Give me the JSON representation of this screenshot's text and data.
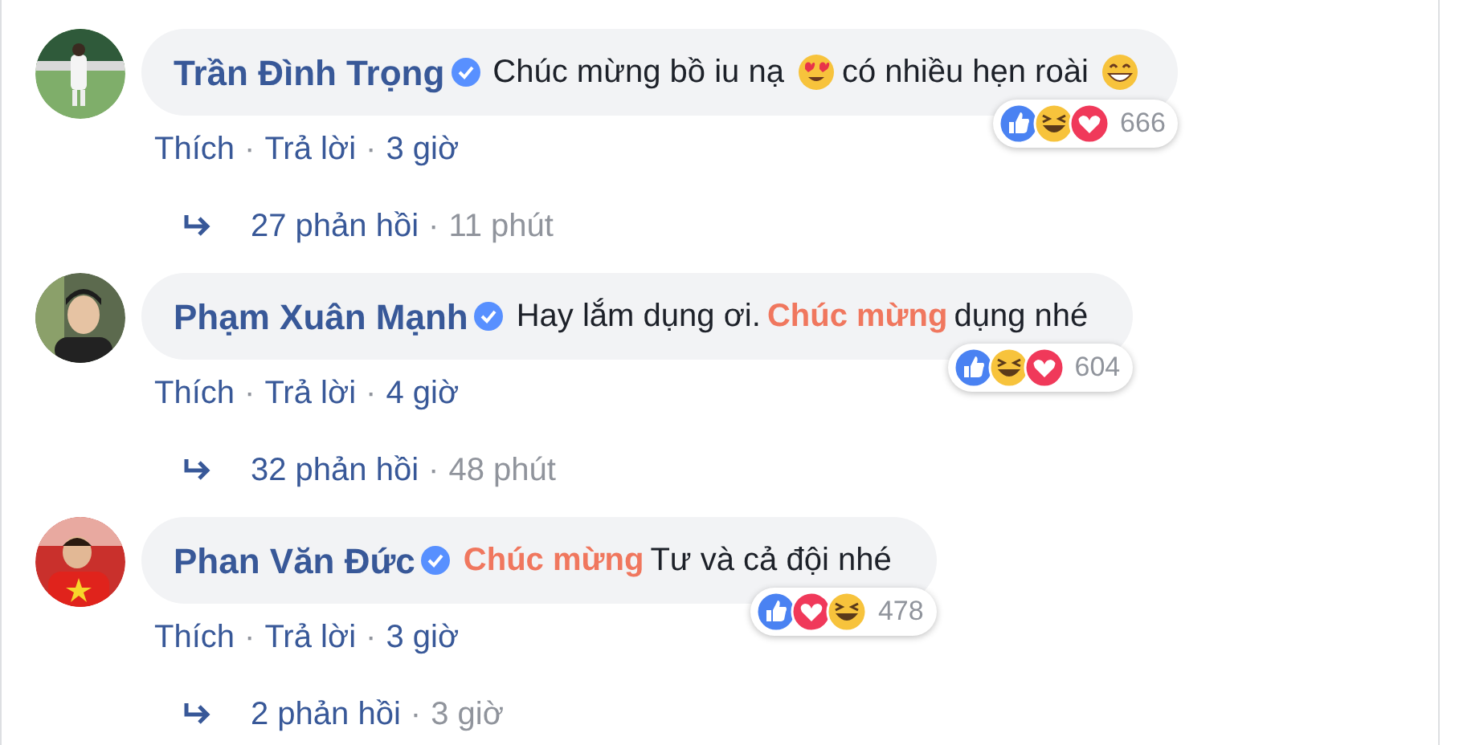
{
  "comments": [
    {
      "author": "Trần Đình Trọng",
      "avatar": {
        "kind": "picture"
      },
      "body": [
        {
          "kind": "text",
          "text": "Chúc mừng bồ iu nạ"
        },
        {
          "kind": "heart-eyes-emoji"
        },
        {
          "kind": "text",
          "text": "có nhiều hẹn roài"
        },
        {
          "kind": "grin-emoji"
        }
      ],
      "reactions": [
        {
          "kind": "like"
        },
        {
          "kind": "haha"
        },
        {
          "kind": "love"
        }
      ],
      "reaction_count": "666",
      "actions": [
        {
          "kind": "like",
          "text": "Thích"
        },
        {
          "kind": "separator",
          "text": "·"
        },
        {
          "kind": "reply",
          "text": "Trả lời"
        },
        {
          "kind": "separator",
          "text": "·"
        },
        {
          "kind": "time",
          "text": "3 giờ"
        }
      ],
      "replies": [
        {
          "kind": "count",
          "text": "27 phản hồi"
        },
        {
          "kind": "separator",
          "text": "·"
        },
        {
          "kind": "time",
          "text": "11 phút"
        }
      ]
    },
    {
      "author": "Phạm Xuân Mạnh",
      "avatar": {
        "kind": "picture"
      },
      "body": [
        {
          "kind": "text",
          "text": "Hay lắm dụng ơi."
        },
        {
          "kind": "highlight",
          "text": "Chúc mừng"
        },
        {
          "kind": "text",
          "text": "dụng nhé"
        }
      ],
      "reactions": [
        {
          "kind": "like"
        },
        {
          "kind": "haha"
        },
        {
          "kind": "love"
        }
      ],
      "reaction_count": "604",
      "actions": [
        {
          "kind": "like",
          "text": "Thích"
        },
        {
          "kind": "separator",
          "text": "·"
        },
        {
          "kind": "reply",
          "text": "Trả lời"
        },
        {
          "kind": "separator",
          "text": "·"
        },
        {
          "kind": "time",
          "text": "4 giờ"
        }
      ],
      "replies": [
        {
          "kind": "count",
          "text": "32 phản hồi"
        },
        {
          "kind": "separator",
          "text": "·"
        },
        {
          "kind": "time",
          "text": "48 phút"
        }
      ]
    },
    {
      "author": "Phan Văn Đức",
      "avatar": {
        "kind": "picture"
      },
      "body": [
        {
          "kind": "highlight",
          "text": "Chúc mừng"
        },
        {
          "kind": "text",
          "text": "Tư và cả đội nhé"
        }
      ],
      "reactions": [
        {
          "kind": "like"
        },
        {
          "kind": "love"
        },
        {
          "kind": "haha"
        }
      ],
      "reaction_count": "478",
      "actions": [
        {
          "kind": "like",
          "text": "Thích"
        },
        {
          "kind": "separator",
          "text": "·"
        },
        {
          "kind": "reply",
          "text": "Trả lời"
        },
        {
          "kind": "separator",
          "text": "·"
        },
        {
          "kind": "time",
          "text": "3 giờ"
        }
      ],
      "replies": [
        {
          "kind": "count",
          "text": "2 phản hồi"
        },
        {
          "kind": "separator",
          "text": "·"
        },
        {
          "kind": "time",
          "text": "3 giờ"
        }
      ]
    }
  ]
}
